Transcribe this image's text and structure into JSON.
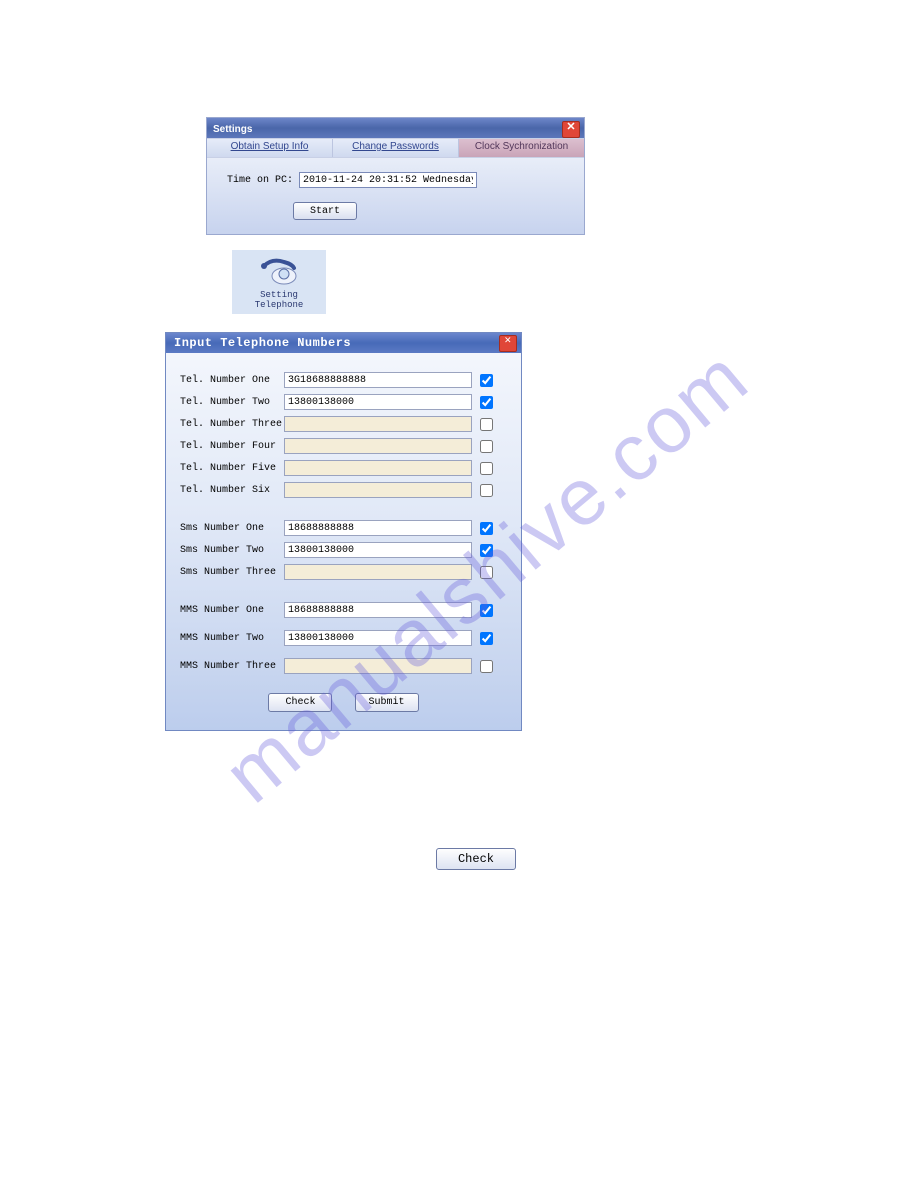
{
  "watermark": "manualshive.com",
  "settings": {
    "title": "Settings",
    "tabs": [
      "Obtain Setup Info",
      "Change Passwords",
      "Clock Sychronization"
    ],
    "active_tab_index": 2,
    "time_label": "Time on PC:",
    "time_value": "2010-11-24 20:31:52 Wednesday",
    "start_label": "Start"
  },
  "telephone_icon": {
    "label": "Setting Telephone"
  },
  "input_window": {
    "title": "Input Telephone Numbers",
    "tel": [
      {
        "label": "Tel. Number One",
        "value": "3G18688888888",
        "checked": true,
        "enabled": true
      },
      {
        "label": "Tel. Number Two",
        "value": "13800138000",
        "checked": true,
        "enabled": true
      },
      {
        "label": "Tel. Number Three",
        "value": "",
        "checked": false,
        "enabled": false
      },
      {
        "label": "Tel. Number Four",
        "value": "",
        "checked": false,
        "enabled": false
      },
      {
        "label": "Tel. Number Five",
        "value": "",
        "checked": false,
        "enabled": false
      },
      {
        "label": "Tel. Number Six",
        "value": "",
        "checked": false,
        "enabled": false
      }
    ],
    "sms": [
      {
        "label": "Sms Number One",
        "value": "18688888888",
        "checked": true,
        "enabled": true
      },
      {
        "label": "Sms Number Two",
        "value": "13800138000",
        "checked": true,
        "enabled": true
      },
      {
        "label": "Sms Number Three",
        "value": "",
        "checked": false,
        "enabled": false
      }
    ],
    "mms": [
      {
        "label": "MMS Number One",
        "value": "18688888888",
        "checked": true,
        "enabled": true
      },
      {
        "label": "MMS Number Two",
        "value": "13800138000",
        "checked": true,
        "enabled": true
      },
      {
        "label": "MMS Number Three",
        "value": "",
        "checked": false,
        "enabled": false
      }
    ],
    "check_label": "Check",
    "submit_label": "Submit"
  },
  "standalone_check_label": "Check"
}
